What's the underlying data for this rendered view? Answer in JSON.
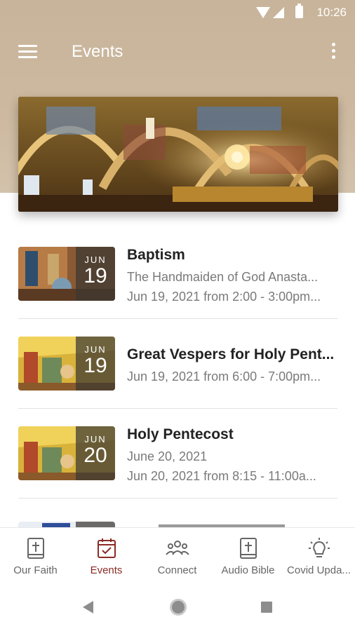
{
  "status_bar": {
    "time": "10:26"
  },
  "app_bar": {
    "title": "Events"
  },
  "colors": {
    "header": "#c8b49a",
    "accent": "#8b2b25",
    "icon": "#666666"
  },
  "events": [
    {
      "title": "Baptism",
      "month": "JUN",
      "day": "19",
      "line1": "The Handmaiden of God Anasta...",
      "line2": "Jun 19, 2021 from 2:00 - 3:00pm..."
    },
    {
      "title": "Great Vespers for Holy Pent...",
      "month": "JUN",
      "day": "19",
      "line1": "Jun 19, 2021 from 6:00 - 7:00pm..."
    },
    {
      "title": "Holy Pentecost",
      "month": "JUN",
      "day": "20",
      "line1": "June 20, 2021",
      "line2": "Jun 20, 2021 from 8:15 - 11:00a..."
    }
  ],
  "bottom_nav": [
    {
      "label": "Our Faith",
      "icon": "book-cross-icon"
    },
    {
      "label": "Events",
      "icon": "calendar-check-icon",
      "active": true
    },
    {
      "label": "Connect",
      "icon": "people-icon"
    },
    {
      "label": "Audio Bible",
      "icon": "bible-icon"
    },
    {
      "label": "Covid Upda...",
      "icon": "lightbulb-icon"
    }
  ]
}
